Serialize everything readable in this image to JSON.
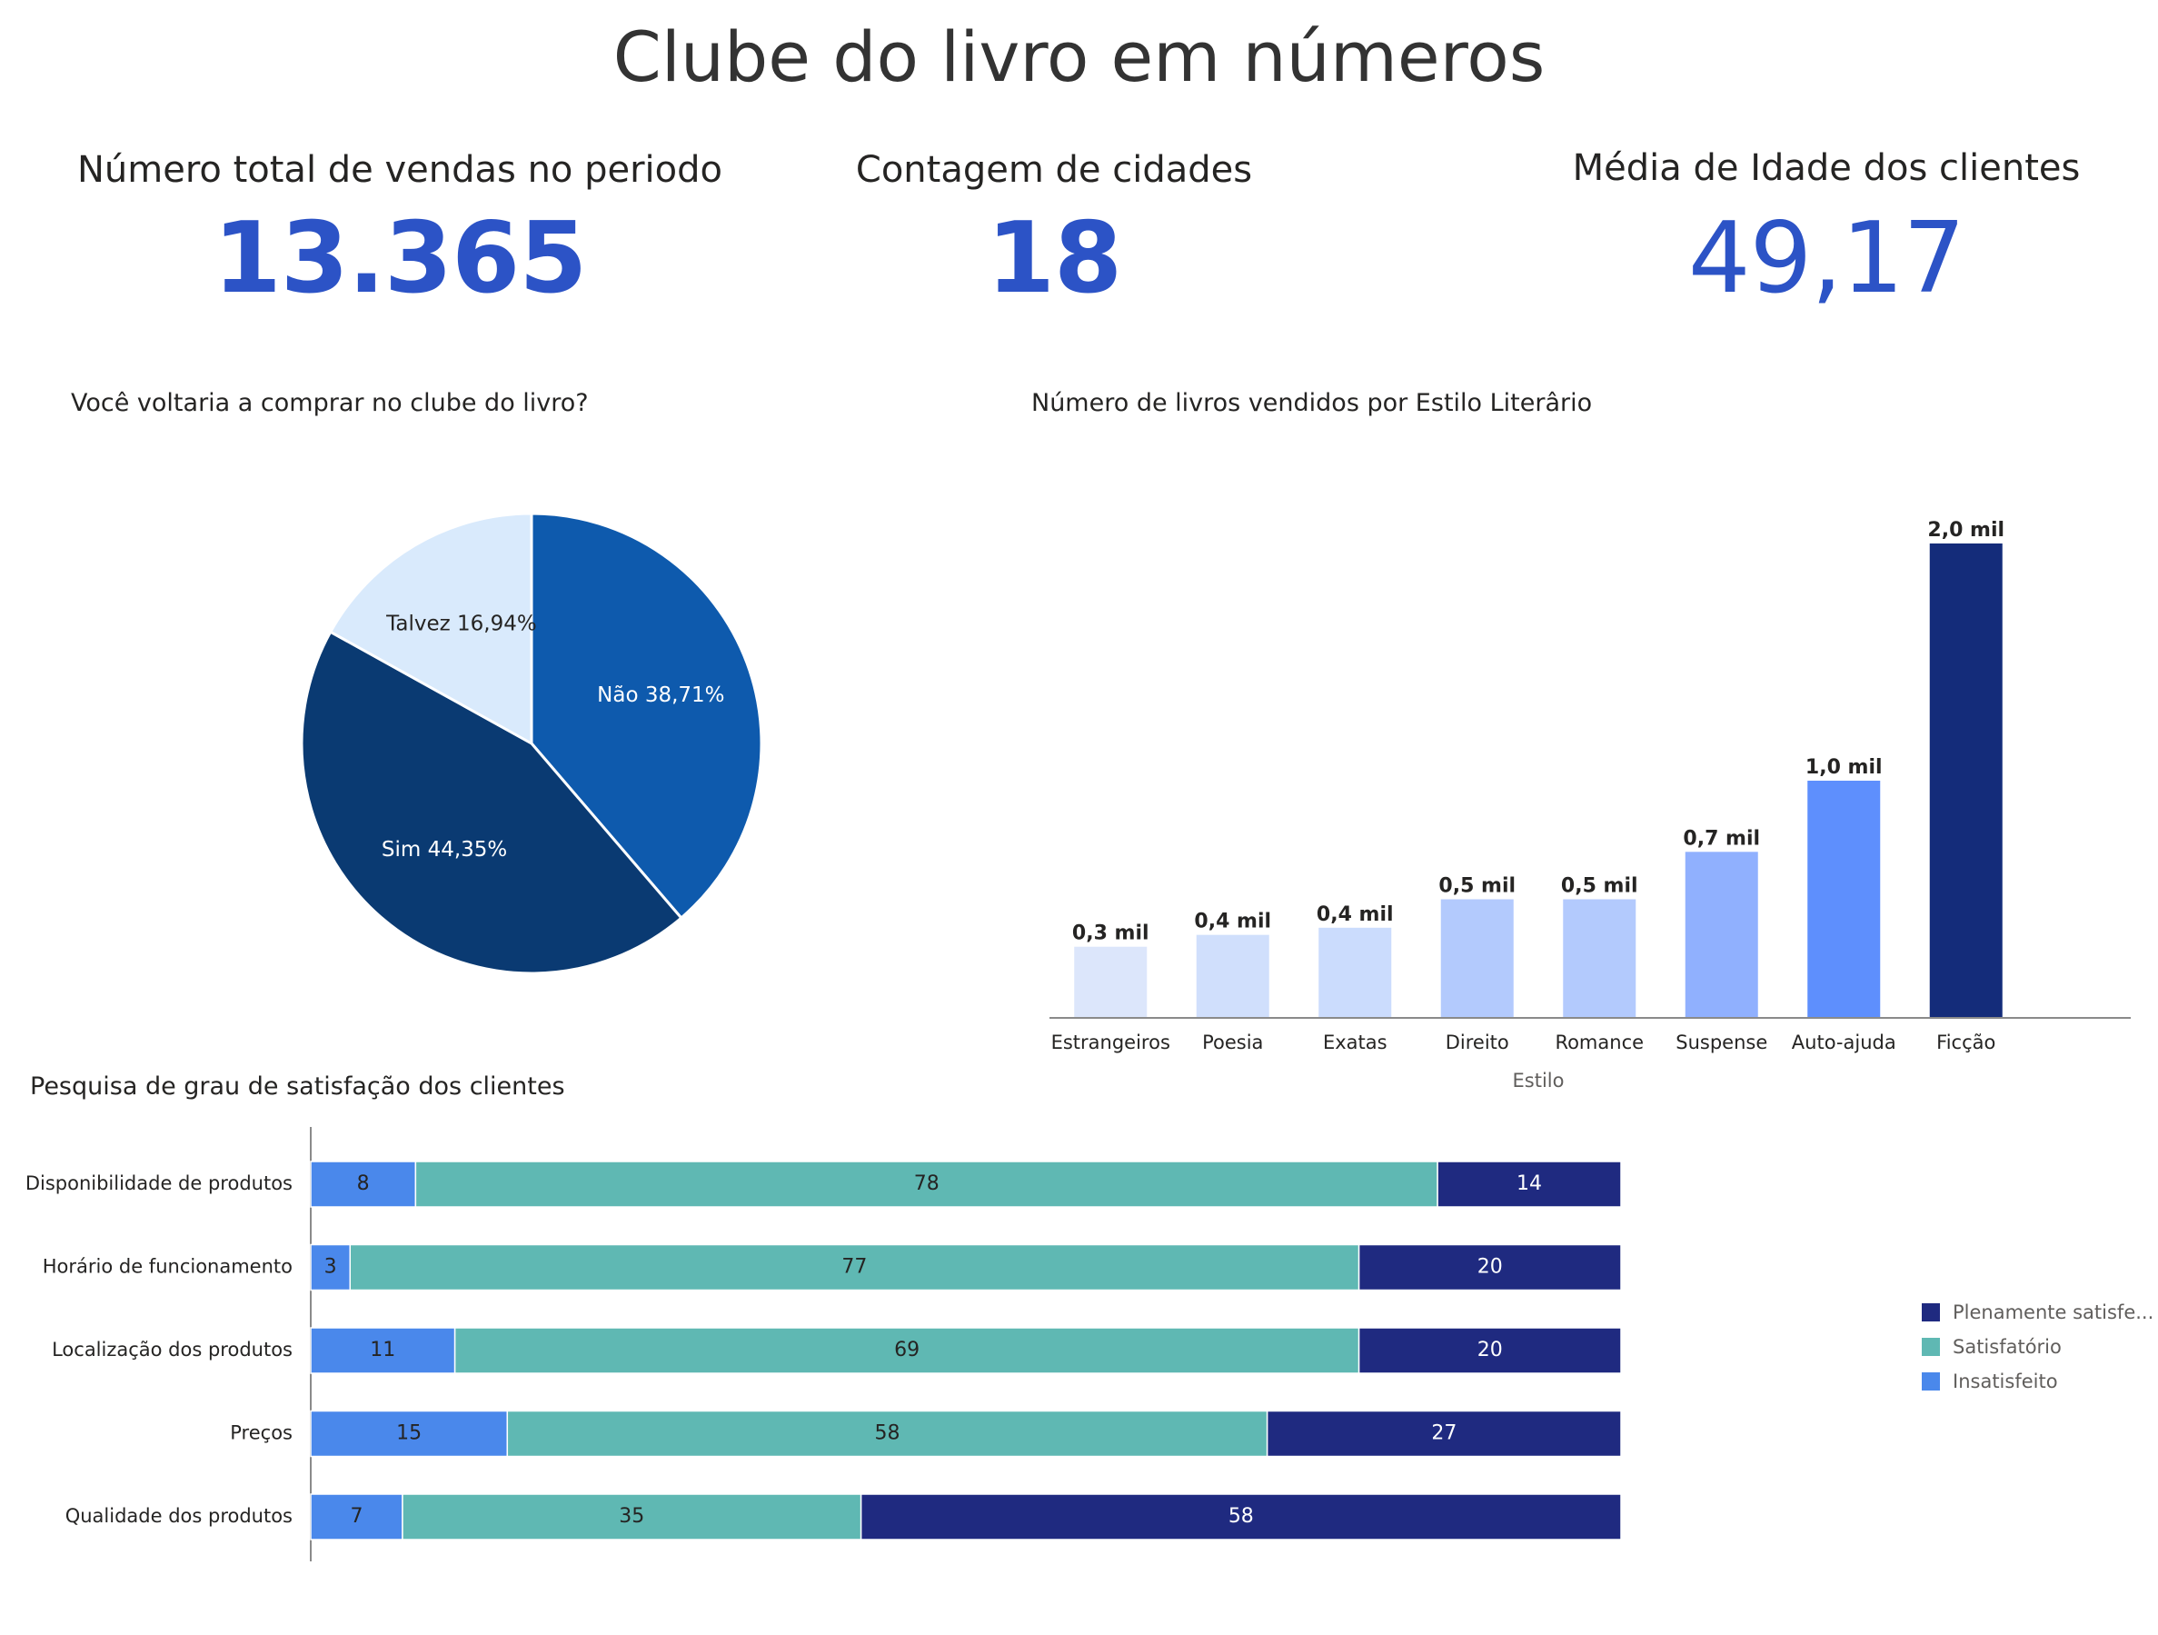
{
  "page": {
    "title": "Clube do livro em números"
  },
  "kpis": [
    {
      "label": "Número total de vendas no periodo",
      "value": "13.365"
    },
    {
      "label": "Contagem de cidades",
      "value": "18"
    },
    {
      "label": "Média de Idade dos clientes",
      "value": "49,17"
    }
  ],
  "colors": {
    "kpi_value": "#2c53c6",
    "pie_sim": "#0a3a72",
    "pie_nao": "#0e5aad",
    "pie_talvez": "#d9eafc",
    "bar_ficcao": "#142c7a",
    "insatisfeito": "#4a88eb",
    "satisfatorio": "#5fb8b3",
    "plenamente": "#1f2a80"
  },
  "chart_data": [
    {
      "type": "pie",
      "title": "Você voltaria a comprar no clube do livro?",
      "slices": [
        {
          "label": "Não",
          "value": 38.71,
          "display": "Não 38,71%",
          "color": "#0e5aad",
          "text_color": "#ffffff"
        },
        {
          "label": "Sim",
          "value": 44.35,
          "display": "Sim 44,35%",
          "color": "#0a3a72",
          "text_color": "#ffffff"
        },
        {
          "label": "Talvez",
          "value": 16.94,
          "display": "Talvez 16,94%",
          "color": "#d9eafc",
          "text_color": "#252423"
        }
      ]
    },
    {
      "type": "bar",
      "title": "Número de livros vendidos por Estilo Literârio",
      "xlabel": "Estilo",
      "ylabel": "",
      "categories": [
        "Estrangeiros",
        "Poesia",
        "Exatas",
        "Direito",
        "Romance",
        "Suspense",
        "Auto-ajuda",
        "Ficção"
      ],
      "values": [
        300,
        350,
        380,
        500,
        500,
        700,
        1000,
        2000
      ],
      "data_labels": [
        "0,3 mil",
        "0,4 mil",
        "0,4 mil",
        "0,5 mil",
        "0,5 mil",
        "0,7 mil",
        "1,0 mil",
        "2,0 mil"
      ],
      "colors": [
        "#dce6fb",
        "#d0dffc",
        "#cbdcfd",
        "#b3cafd",
        "#b3cafd",
        "#90b0fe",
        "#5e8ffd",
        "#142c7a"
      ],
      "ylim": [
        0,
        2000
      ]
    },
    {
      "type": "bar",
      "orientation": "horizontal-stacked",
      "title": "Pesquisa de grau de satisfação dos clientes",
      "categories": [
        "Disponibilidade de produtos",
        "Horário de funcionamento",
        "Localização dos produtos",
        "Preços",
        "Qualidade dos produtos"
      ],
      "series": [
        {
          "name": "Insatisfeito",
          "values": [
            8,
            3,
            11,
            15,
            7
          ],
          "color": "#4a88eb",
          "text_color": "#252423"
        },
        {
          "name": "Satisfatório",
          "values": [
            78,
            77,
            69,
            58,
            35
          ],
          "color": "#5fb8b3",
          "text_color": "#252423"
        },
        {
          "name": "Plenamente satisfe...",
          "values": [
            14,
            20,
            20,
            27,
            58
          ],
          "color": "#1f2a80",
          "text_color": "#ffffff"
        }
      ],
      "legend": [
        "Plenamente satisfe...",
        "Satisfatório",
        "Insatisfeito"
      ],
      "legend_position": "right",
      "xlim": [
        0,
        100
      ]
    }
  ]
}
